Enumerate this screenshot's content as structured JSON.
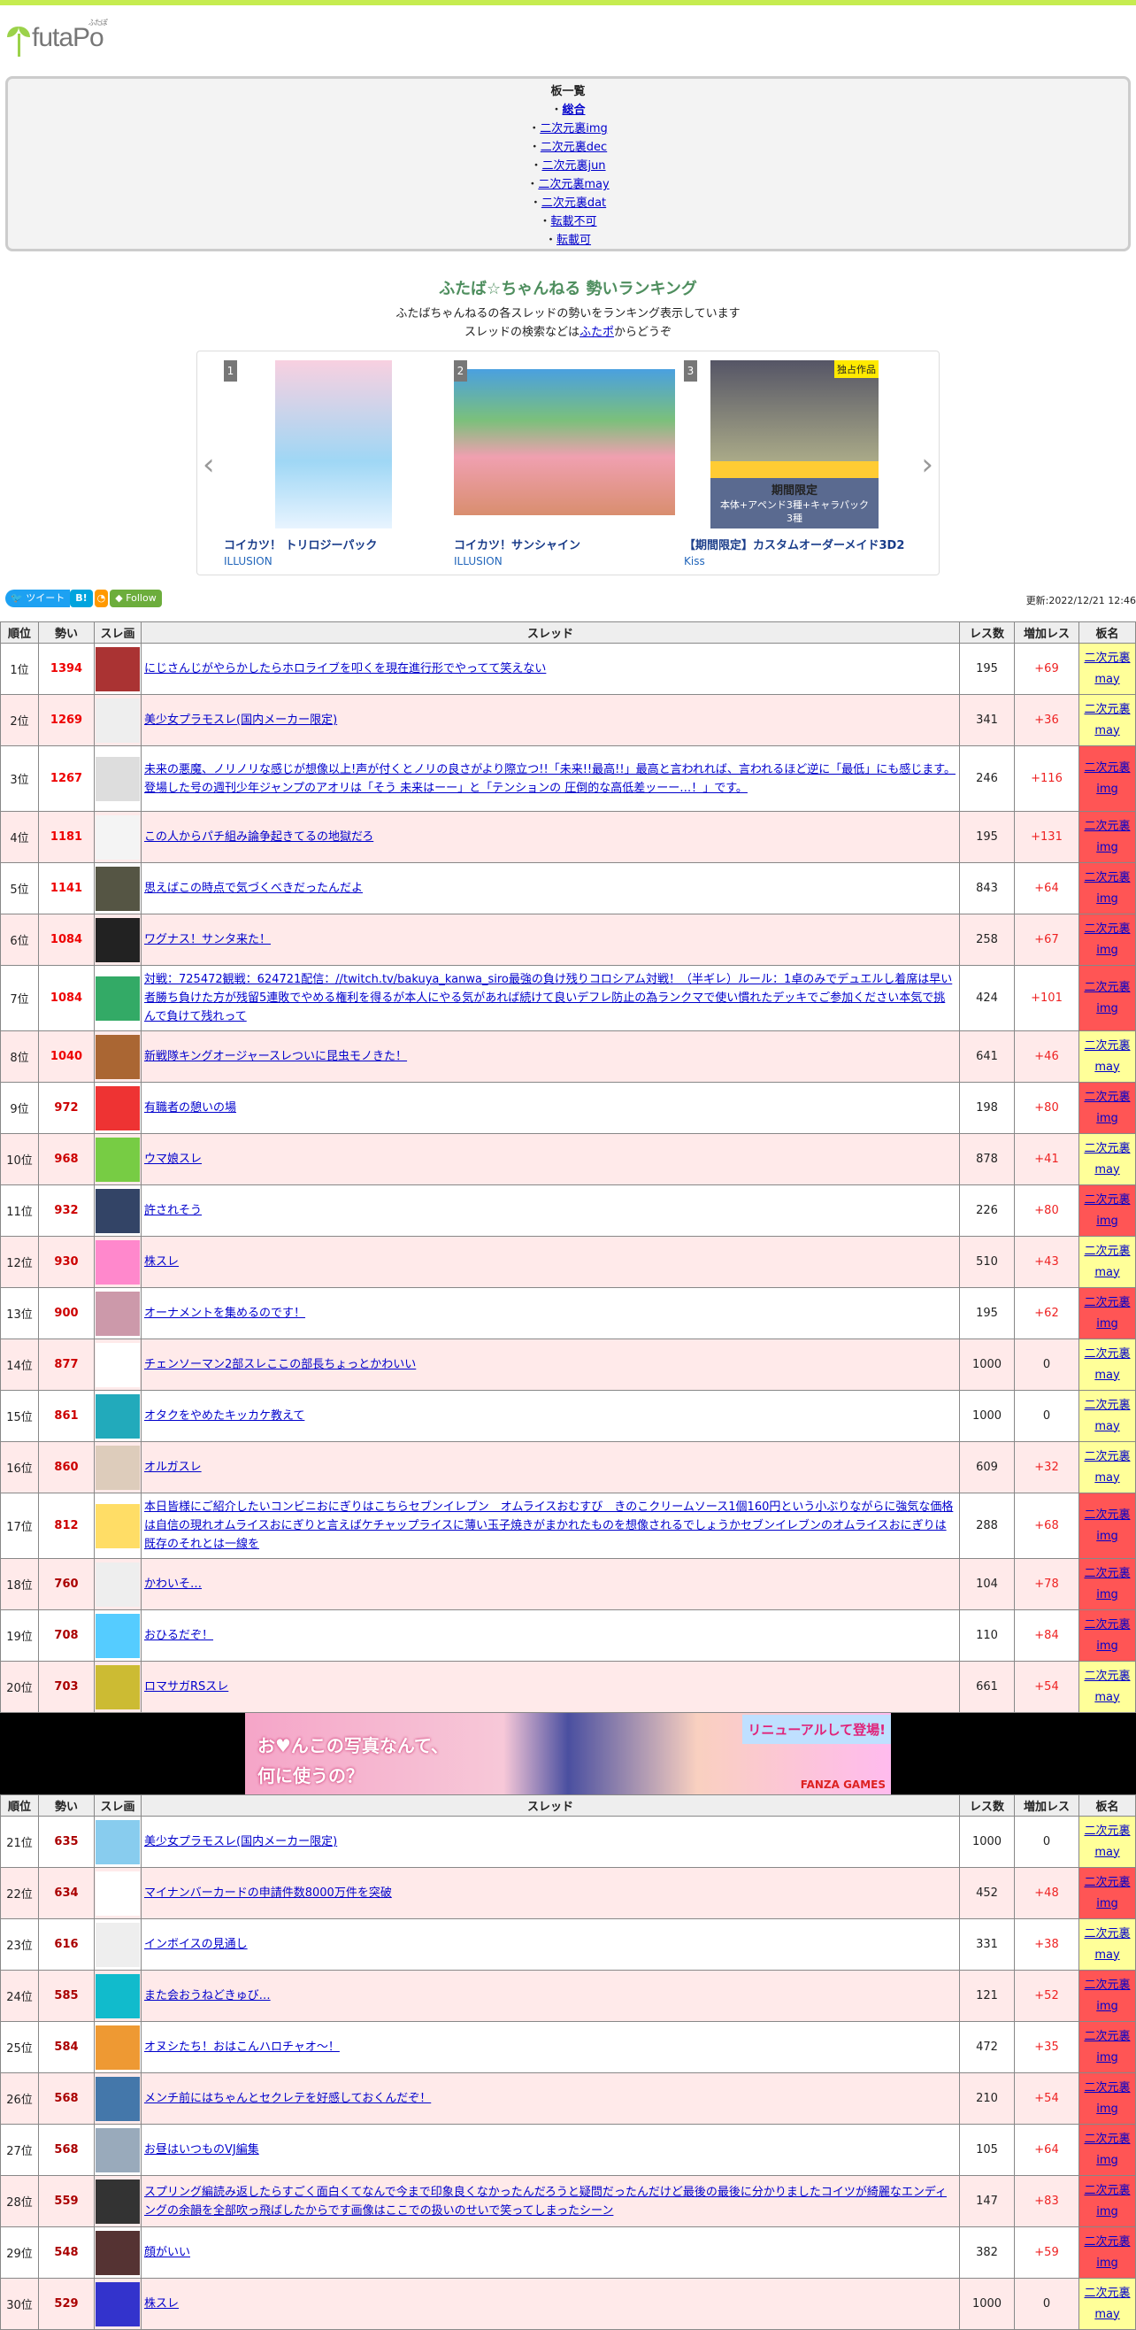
{
  "logo": {
    "text": "futaPo",
    "kana": "ふたぽ"
  },
  "boards": {
    "heading": "板一覧",
    "items": [
      "総合",
      "二次元裏img",
      "二次元裏dec",
      "二次元裏jun",
      "二次元裏may",
      "二次元裏dat",
      "転載不可",
      "転載可"
    ]
  },
  "ranking": {
    "title": "ふたば☆ちゃんねる 勢いランキング",
    "desc": "ふたばちゃんねるの各スレッドの勢いをランキング表示しています",
    "search_prefix": "スレッドの検索などは",
    "search_link": "ふたポ",
    "search_suffix": "からどうぞ"
  },
  "carousel": [
    {
      "num": "1",
      "title": "コイカツ！ トリロジーパック",
      "maker": "ILLUSION"
    },
    {
      "num": "2",
      "title": "コイカツ！サンシャイン",
      "maker": "ILLUSION"
    },
    {
      "num": "3",
      "title": "【期間限定】カスタムオーダーメイド3D2",
      "maker": "Kiss",
      "badge": "独占作品",
      "banner1": "期間限定",
      "banner2": "本体+アペンド3種+キャラパック3種"
    }
  ],
  "share": {
    "tweet": "ツイート",
    "hatena": "B!",
    "follow": "Follow",
    "updated": "更新:2022/12/21 12:46"
  },
  "headers": [
    "順位",
    "勢い",
    "スレ画",
    "スレッド",
    "レス数",
    "増加レス",
    "板名"
  ],
  "board_prefix": "二次元裏",
  "colors": {
    "may": "#ffff99",
    "img": "#ff5555",
    "accent": "#c6ec50"
  },
  "rows1": [
    [
      "1位",
      "1394",
      "にじさんじがやらかしたらホロライブを叩くを現在進行形でやってて笑えない",
      "195",
      "+69",
      "may"
    ],
    [
      "2位",
      "1269",
      "美少女プラモスレ(国内メーカー限定)",
      "341",
      "+36",
      "may"
    ],
    [
      "3位",
      "1267",
      "未来の悪魔、ノリノリな感じが想像以上!声が付くとノリの良さがより際立つ!!「未来!!最高!!」最高と言われれば、言われるほど逆に「最低」にも感じます。登場した号の週刊少年ジャンプのアオリは「そう 未来はーー」と「テンションの 圧倒的な高低差ッーー…！」です。",
      "246",
      "+116",
      "img"
    ],
    [
      "4位",
      "1181",
      "この人からパチ組み論争起きてるの地獄だろ",
      "195",
      "+131",
      "img"
    ],
    [
      "5位",
      "1141",
      "思えばこの時点で気づくべきだったんだよ",
      "843",
      "+64",
      "img"
    ],
    [
      "6位",
      "1084",
      "ワグナス！サンタ来た！",
      "258",
      "+67",
      "img"
    ],
    [
      "7位",
      "1084",
      "対戦：725472観戦：624721配信：//twitch.tv/bakuya_kanwa_siro最強の負け残りコロシアム対戦！（半ギレ）ルール：1卓のみでデュエルし着席は早い者勝ち負けた方が残留5連敗でやめる権利を得るが本人にやる気があれば続けて良いデフレ防止の為ランクマで使い慣れたデッキでご参加ください本気で挑んで負けて残れって",
      "424",
      "+101",
      "img"
    ],
    [
      "8位",
      "1040",
      "新戦隊キングオージャースレついに昆虫モノきた！",
      "641",
      "+46",
      "may"
    ],
    [
      "9位",
      "972",
      "有職者の憩いの場",
      "198",
      "+80",
      "img"
    ],
    [
      "10位",
      "968",
      "ウマ娘スレ",
      "878",
      "+41",
      "may"
    ],
    [
      "11位",
      "932",
      "許されそう",
      "226",
      "+80",
      "img"
    ],
    [
      "12位",
      "930",
      "株スレ",
      "510",
      "+43",
      "may"
    ],
    [
      "13位",
      "900",
      "オーナメントを集めるのです！",
      "195",
      "+62",
      "img"
    ],
    [
      "14位",
      "877",
      "チェンソーマン2部スレここの部長ちょっとかわいい",
      "1000",
      "0",
      "may"
    ],
    [
      "15位",
      "861",
      "オタクをやめたキッカケ教えて",
      "1000",
      "0",
      "may"
    ],
    [
      "16位",
      "860",
      "オルガスレ",
      "609",
      "+32",
      "may"
    ],
    [
      "17位",
      "812",
      "本日皆様にご紹介したいコンビニおにぎりはこちらセブンイレブン　オムライスおむすび　きのこクリームソース1個160円という小ぶりながらに強気な価格は自信の現れオムライスおにぎりと言えばケチャップライスに薄い玉子焼きがまかれたものを想像されるでしょうかセブンイレブンのオムライスおにぎりは既存のそれとは一線を",
      "288",
      "+68",
      "img"
    ],
    [
      "18位",
      "760",
      "かわいそ…",
      "104",
      "+78",
      "img"
    ],
    [
      "19位",
      "708",
      "おひるだぞ！",
      "110",
      "+84",
      "img"
    ],
    [
      "20位",
      "703",
      "ロマサガRSスレ",
      "661",
      "+54",
      "may"
    ]
  ],
  "ad": {
    "line1": "お♥んこの写真なんて、",
    "line2": "何に使うの？",
    "tag": "リニューアルして登場!",
    "brand": "FANZA GAMES"
  },
  "rows2": [
    [
      "21位",
      "635",
      "美少女プラモスレ(国内メーカー限定)",
      "1000",
      "0",
      "may"
    ],
    [
      "22位",
      "634",
      "マイナンバーカードの申請件数8000万件を突破",
      "452",
      "+48",
      "img"
    ],
    [
      "23位",
      "616",
      "インボイスの見通し",
      "331",
      "+38",
      "may"
    ],
    [
      "24位",
      "585",
      "また会おうねどきゅび…",
      "121",
      "+52",
      "img"
    ],
    [
      "25位",
      "584",
      "オヌシたち！おはこんハロチャオ～！",
      "472",
      "+35",
      "img"
    ],
    [
      "26位",
      "568",
      "メンチ前にはちゃんとセクレテを好感しておくんだぞ！",
      "210",
      "+54",
      "img"
    ],
    [
      "27位",
      "568",
      "お昼はいつものVJ編集",
      "105",
      "+64",
      "img"
    ],
    [
      "28位",
      "559",
      "スプリング編読み返したらすごく面白くてなんで今まで印象良くなかったんだろうと疑問だったんだけど最後の最後に分かりましたコイツが綺麗なエンディングの余韻を全部吹っ飛ばしたからです画像はここでの扱いのせいで笑ってしまったシーン",
      "147",
      "+83",
      "img"
    ],
    [
      "29位",
      "548",
      "顔がいい",
      "382",
      "+59",
      "img"
    ],
    [
      "30位",
      "529",
      "株スレ",
      "1000",
      "0",
      "may"
    ]
  ]
}
